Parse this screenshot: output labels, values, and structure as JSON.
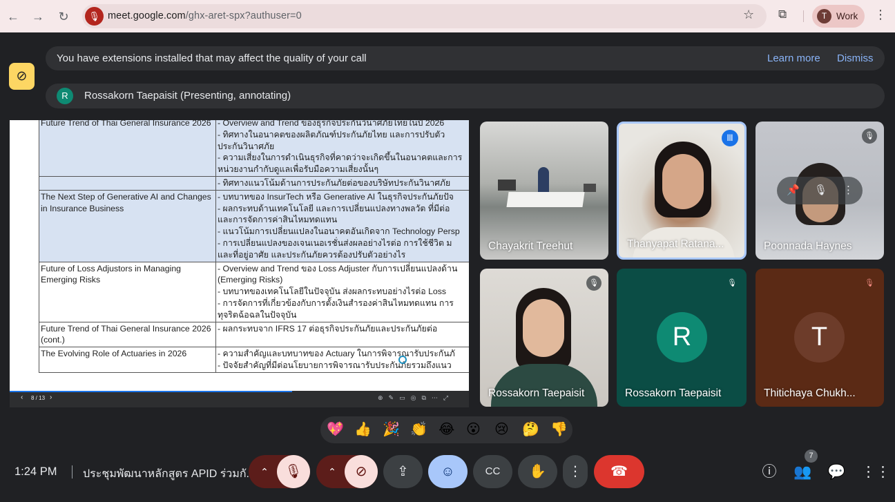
{
  "browser": {
    "url_host": "meet.google.com",
    "url_path": "/ghx-aret-spx?authuser=0",
    "profile_initial": "T",
    "profile_label": "Work"
  },
  "banner": {
    "text": "You have extensions installed that may affect the quality of your call",
    "learn_more": "Learn more",
    "dismiss": "Dismiss"
  },
  "presenter": {
    "initial": "R",
    "text": "Rossakorn Taepaisit (Presenting, annotating)"
  },
  "slide": {
    "rows": [
      {
        "left": "Future Trend of Thai General Insurance 2026",
        "right": "- Overview and Trend ของธุรกิจประกันวินาศภัยไทยในปี 2026\n- ทิศทางในอนาคตของผลิตภัณฑ์ประกันภัยไทย และการปรับตัว\nประกันวินาศภัย\n- ความเสี่ยงในการดำเนินธุรกิจที่คาดว่าจะเกิดขึ้นในอนาคตและการ\nหน่วยงานกำกับดูแลเพื่อรับมือความเสี่ยงนั้นๆ",
        "highlight": true
      },
      {
        "left": "",
        "right": "- ทิศทางแนวโน้มด้านการประกันภัยต่อของบริษัทประกันวินาศภัย",
        "highlight": true
      },
      {
        "left": "The Next Step of Generative AI and Changes in Insurance Business",
        "right": "- บทบาทของ InsurTech หรือ Generative AI ในธุรกิจประกันภัยปัจ\n- ผลกระทบด้านเทคโนโลยี และการเปลี่ยนแปลงทางพลวัต ที่มีต่อ\nและการจัดการค่าสินไหมทดแทน\n- แนวโน้มการเปลี่ยนแปลงในอนาคตอันเกิดจาก Technology Persp\n- การเปลี่ยนแปลงของเจนเนอเรชั่นส่งผลอย่างไรต่อ การใช้ชีวิต ม\nและที่อยู่อาศัย และประกันภัยควรต้องปรับตัวอย่างไร",
        "highlight": true
      },
      {
        "left": "Future of Loss Adjustors in Managing Emerging Risks",
        "right": "- Overview and Trend ของ Loss Adjuster กับการเปลี่ยนแปลงด้าน\n(Emerging Risks)\n- บทบาทของเทคโนโลยีในปัจจุบัน ส่งผลกระทบอย่างไรต่อ Loss\n- การจัดการที่เกี่ยวข้องกับการตั้งเงินสำรองค่าสินไหมทดแทน การ\nทุจริตฉ้อฉลในปัจจุบัน",
        "highlight": false
      },
      {
        "left": "Future Trend of Thai General Insurance 2026 (cont.)",
        "right": "- ผลกระทบจาก IFRS 17 ต่อธุรกิจประกันภัยและประกันภัยต่อ",
        "highlight": false
      },
      {
        "left": "The Evolving Role of Actuaries in 2026",
        "right": "- ความสำคัญและบทบาทของ Actuary ในการพิจารณารับประกันภั\n- ปัจจัยสำคัญที่มีต่อนโยบายการพิจารณารับประกันภัยรวมถึงแนว",
        "highlight": false
      }
    ],
    "page_indicator": "8 / 13",
    "progress": 0.615
  },
  "tiles": [
    {
      "name": "Chayakrit Treehut"
    },
    {
      "name": "Thanyapat Ratana..."
    },
    {
      "name": "Poonnada Haynes"
    },
    {
      "name": "Rossakorn Taepaisit"
    },
    {
      "name": "Rossakorn Taepaisit",
      "initial": "R",
      "color": "#0e8a73"
    },
    {
      "name": "Thitichaya Chukh...",
      "initial": "T",
      "color": "#6d3c2a"
    }
  ],
  "reactions": [
    "💖",
    "👍",
    "🎉",
    "👏",
    "😂",
    "😮",
    "😢",
    "🤔",
    "👎"
  ],
  "bottom": {
    "time": "1:24 PM",
    "meeting_title": "ประชุมพัฒนาหลักสูตร APID ร่วมกั...",
    "participant_count": "7"
  },
  "colors": {
    "mic_off": "#f9dedc",
    "leave": "#dc362e",
    "reaction_active": "#8ab4f8"
  }
}
